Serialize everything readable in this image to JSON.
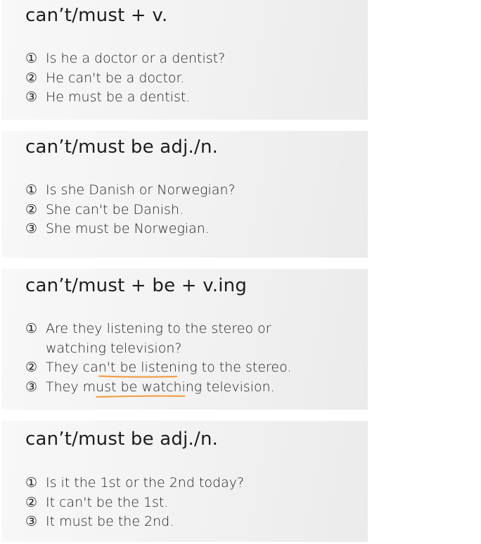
{
  "cards": [
    {
      "title": "can’t/must + v.",
      "lines": [
        {
          "num": "①",
          "text": "Is he a doctor or a dentist?"
        },
        {
          "num": "②",
          "text": "He can't be a doctor."
        },
        {
          "num": "③",
          "text": "He must be a dentist."
        }
      ]
    },
    {
      "title": "can’t/must be adj./n.",
      "lines": [
        {
          "num": "①",
          "text": "Is she Danish or Norwegian?"
        },
        {
          "num": "②",
          "text": "She can't be Danish."
        },
        {
          "num": "③",
          "text": "She must be Norwegian."
        }
      ]
    },
    {
      "title": "can’t/must + be + v.ing",
      "lines": [
        {
          "num": "①",
          "text": "Are they listening to the stereo or",
          "cont": "watching television?"
        },
        {
          "num": "②",
          "pre": "They ca",
          "hl": "n't be listen",
          "post": "ing to the stereo."
        },
        {
          "num": "③",
          "pre": "They m",
          "hl": "ust be watchi",
          "post": "ng television."
        }
      ]
    },
    {
      "title": "can’t/must be adj./n.",
      "lines": [
        {
          "num": "①",
          "text": "Is it the 1st or the 2nd today?"
        },
        {
          "num": "②",
          "text": "It can't be the 1st."
        },
        {
          "num": "③",
          "text": "It must be the 2nd."
        }
      ]
    }
  ],
  "colors": {
    "underline": "#f0a04b"
  }
}
